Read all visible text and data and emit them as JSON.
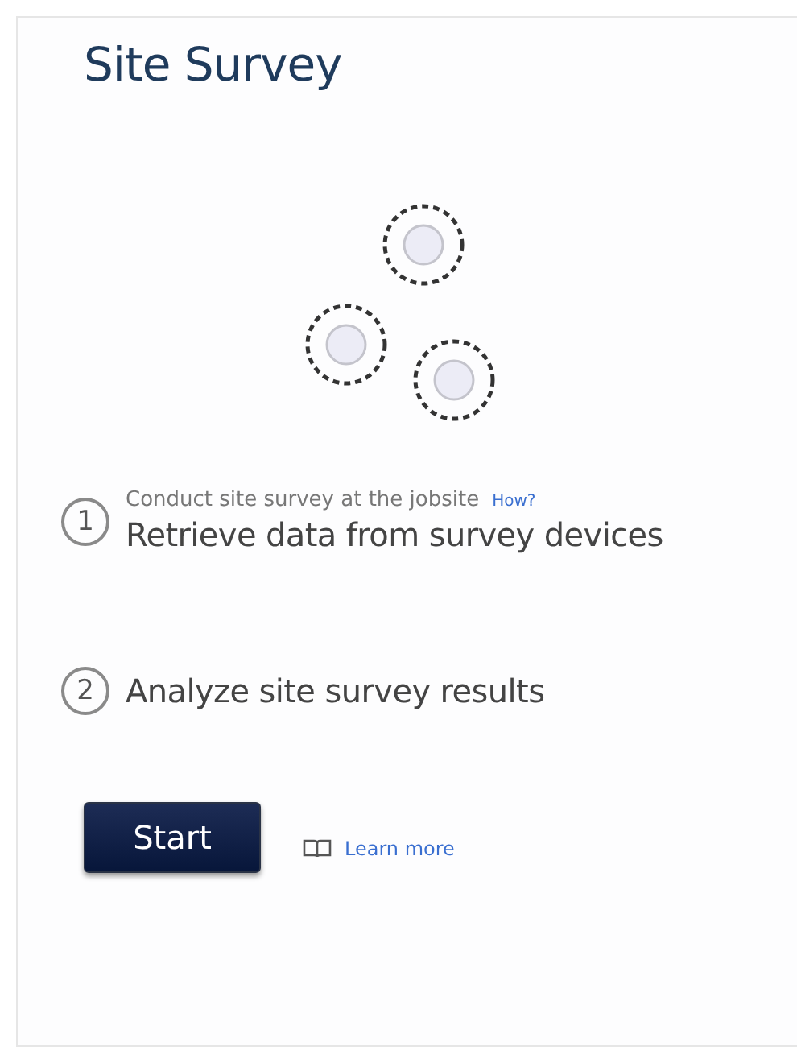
{
  "panel": {
    "title": "Site Survey"
  },
  "steps": [
    {
      "number": "1",
      "hint": "Conduct site survey at the jobsite",
      "hint_link": "How?",
      "label": "Retrieve data from survey devices"
    },
    {
      "number": "2",
      "label": "Analyze site survey results"
    }
  ],
  "actions": {
    "button": "Start",
    "link": "Learn more"
  }
}
